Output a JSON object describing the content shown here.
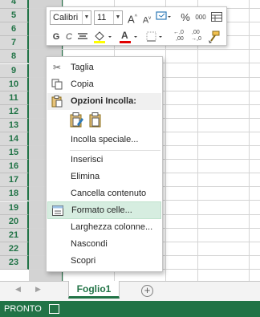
{
  "row_headers": [
    "4",
    "5",
    "6",
    "7",
    "8",
    "9",
    "10",
    "11",
    "12",
    "13",
    "14",
    "15",
    "16",
    "17",
    "18",
    "19",
    "20",
    "21",
    "22",
    "23"
  ],
  "mini_toolbar": {
    "font_name": "Calibri",
    "font_size": "11",
    "grow_font": "A",
    "shrink_font": "A",
    "percent": "%",
    "thousands": "000",
    "bold": "G",
    "italic": "C",
    "font_color_letter": "A",
    "increase_decimal": "←,0\n,00",
    "decrease_decimal": ",00\n→,0"
  },
  "context_menu": {
    "cut": "Taglia",
    "copy": "Copia",
    "paste_options": "Opzioni Incolla:",
    "paste_special": "Incolla speciale...",
    "insert": "Inserisci",
    "delete": "Elimina",
    "clear_contents": "Cancella contenuto",
    "format_cells": "Formato celle...",
    "column_width": "Larghezza colonne...",
    "hide": "Nascondi",
    "unhide": "Scopri"
  },
  "sheet_tabs": {
    "active": "Foglio1"
  },
  "status_bar": {
    "state": "PRONTO"
  },
  "colors": {
    "excel_green": "#217346",
    "highlight": "#d6ede0",
    "font_color_bar": "#e00000"
  }
}
